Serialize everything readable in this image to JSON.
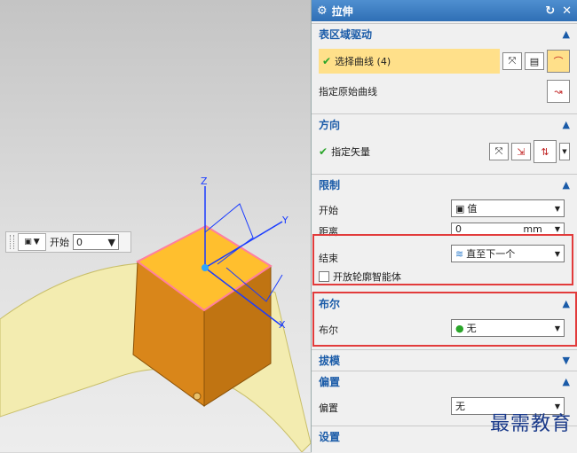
{
  "viewport": {
    "axes": {
      "x": "X",
      "y": "Y",
      "z": "Z"
    },
    "quick_bar": {
      "label": "开始",
      "value": "0"
    }
  },
  "dialog": {
    "title": "拉伸",
    "icons": {
      "title": "gear-icon",
      "reset": "reset-icon",
      "close": "close-icon"
    },
    "sections": {
      "surface_drive": {
        "header": "表区域驱动",
        "select_curve": "选择曲线 (4)",
        "original_curve": "指定原始曲线"
      },
      "direction": {
        "header": "方向",
        "vector": "指定矢量"
      },
      "limits": {
        "header": "限制",
        "start_label": "开始",
        "start_value": "值",
        "distance_label": "距离",
        "distance_value": "0",
        "distance_unit": "mm",
        "end_label": "结束",
        "end_value": "直至下一个",
        "open_profile": "开放轮廓智能体"
      },
      "boolean": {
        "header": "布尔",
        "label": "布尔",
        "value": "无"
      },
      "draft": {
        "header": "拔模"
      },
      "offset": {
        "header": "偏置",
        "label": "偏置",
        "value": "无"
      },
      "settings": {
        "header": "设置"
      }
    }
  },
  "watermark": "最需教育",
  "colors": {
    "accent": "#1a5ba8",
    "highlight": "#ffe08a",
    "box": "#e23b3b",
    "solid": "#e89a1e"
  }
}
